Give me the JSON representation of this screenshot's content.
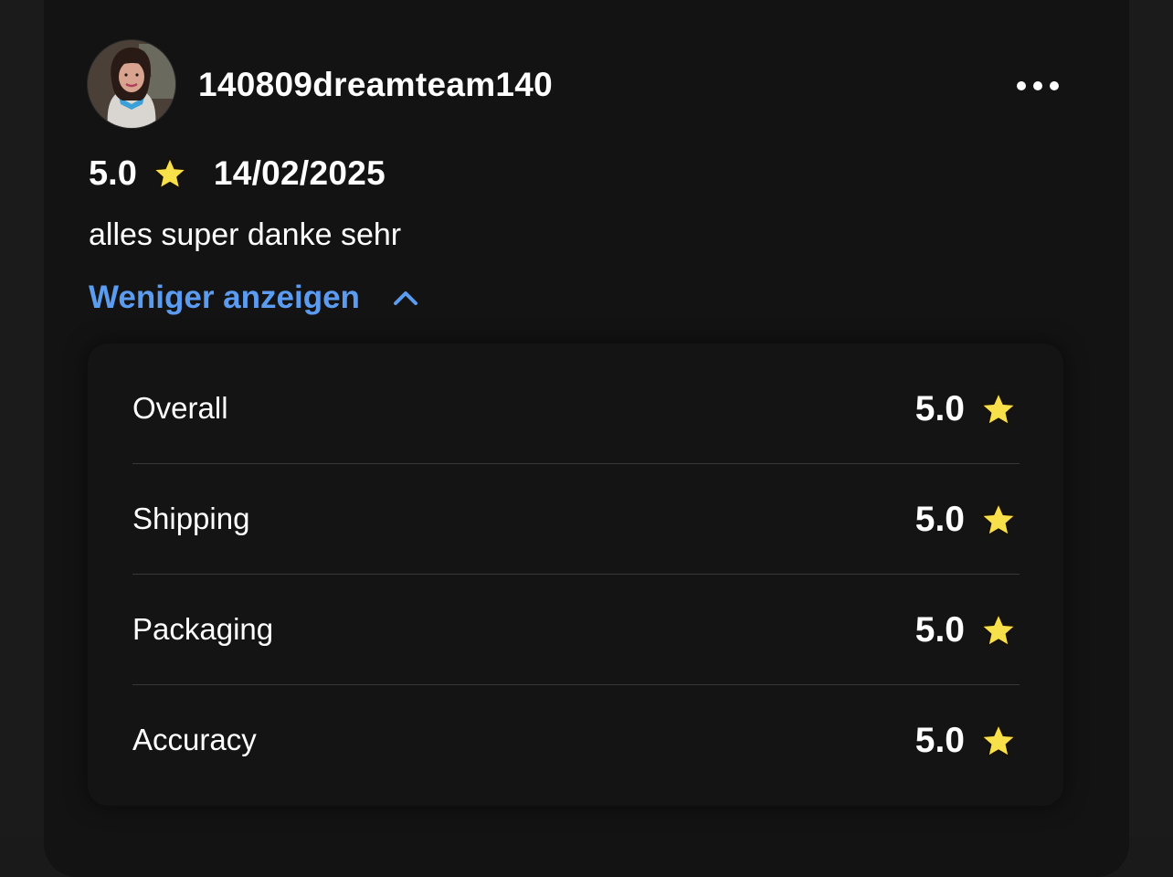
{
  "review": {
    "username": "140809dreamteam140",
    "rating": "5.0",
    "date": "14/02/2025",
    "text": "alles super danke sehr",
    "toggle_label": "Weniger anzeigen",
    "more_icon": "more-horizontal-icon",
    "star_icon": "star-icon",
    "chevron_icon": "chevron-up-icon"
  },
  "breakdown": {
    "rows": [
      {
        "label": "Overall",
        "score": "5.0"
      },
      {
        "label": "Shipping",
        "score": "5.0"
      },
      {
        "label": "Packaging",
        "score": "5.0"
      },
      {
        "label": "Accuracy",
        "score": "5.0"
      }
    ]
  },
  "colors": {
    "background": "#131313",
    "link": "#5b9bf0",
    "star": "#f7e04a",
    "divider": "#383838"
  }
}
